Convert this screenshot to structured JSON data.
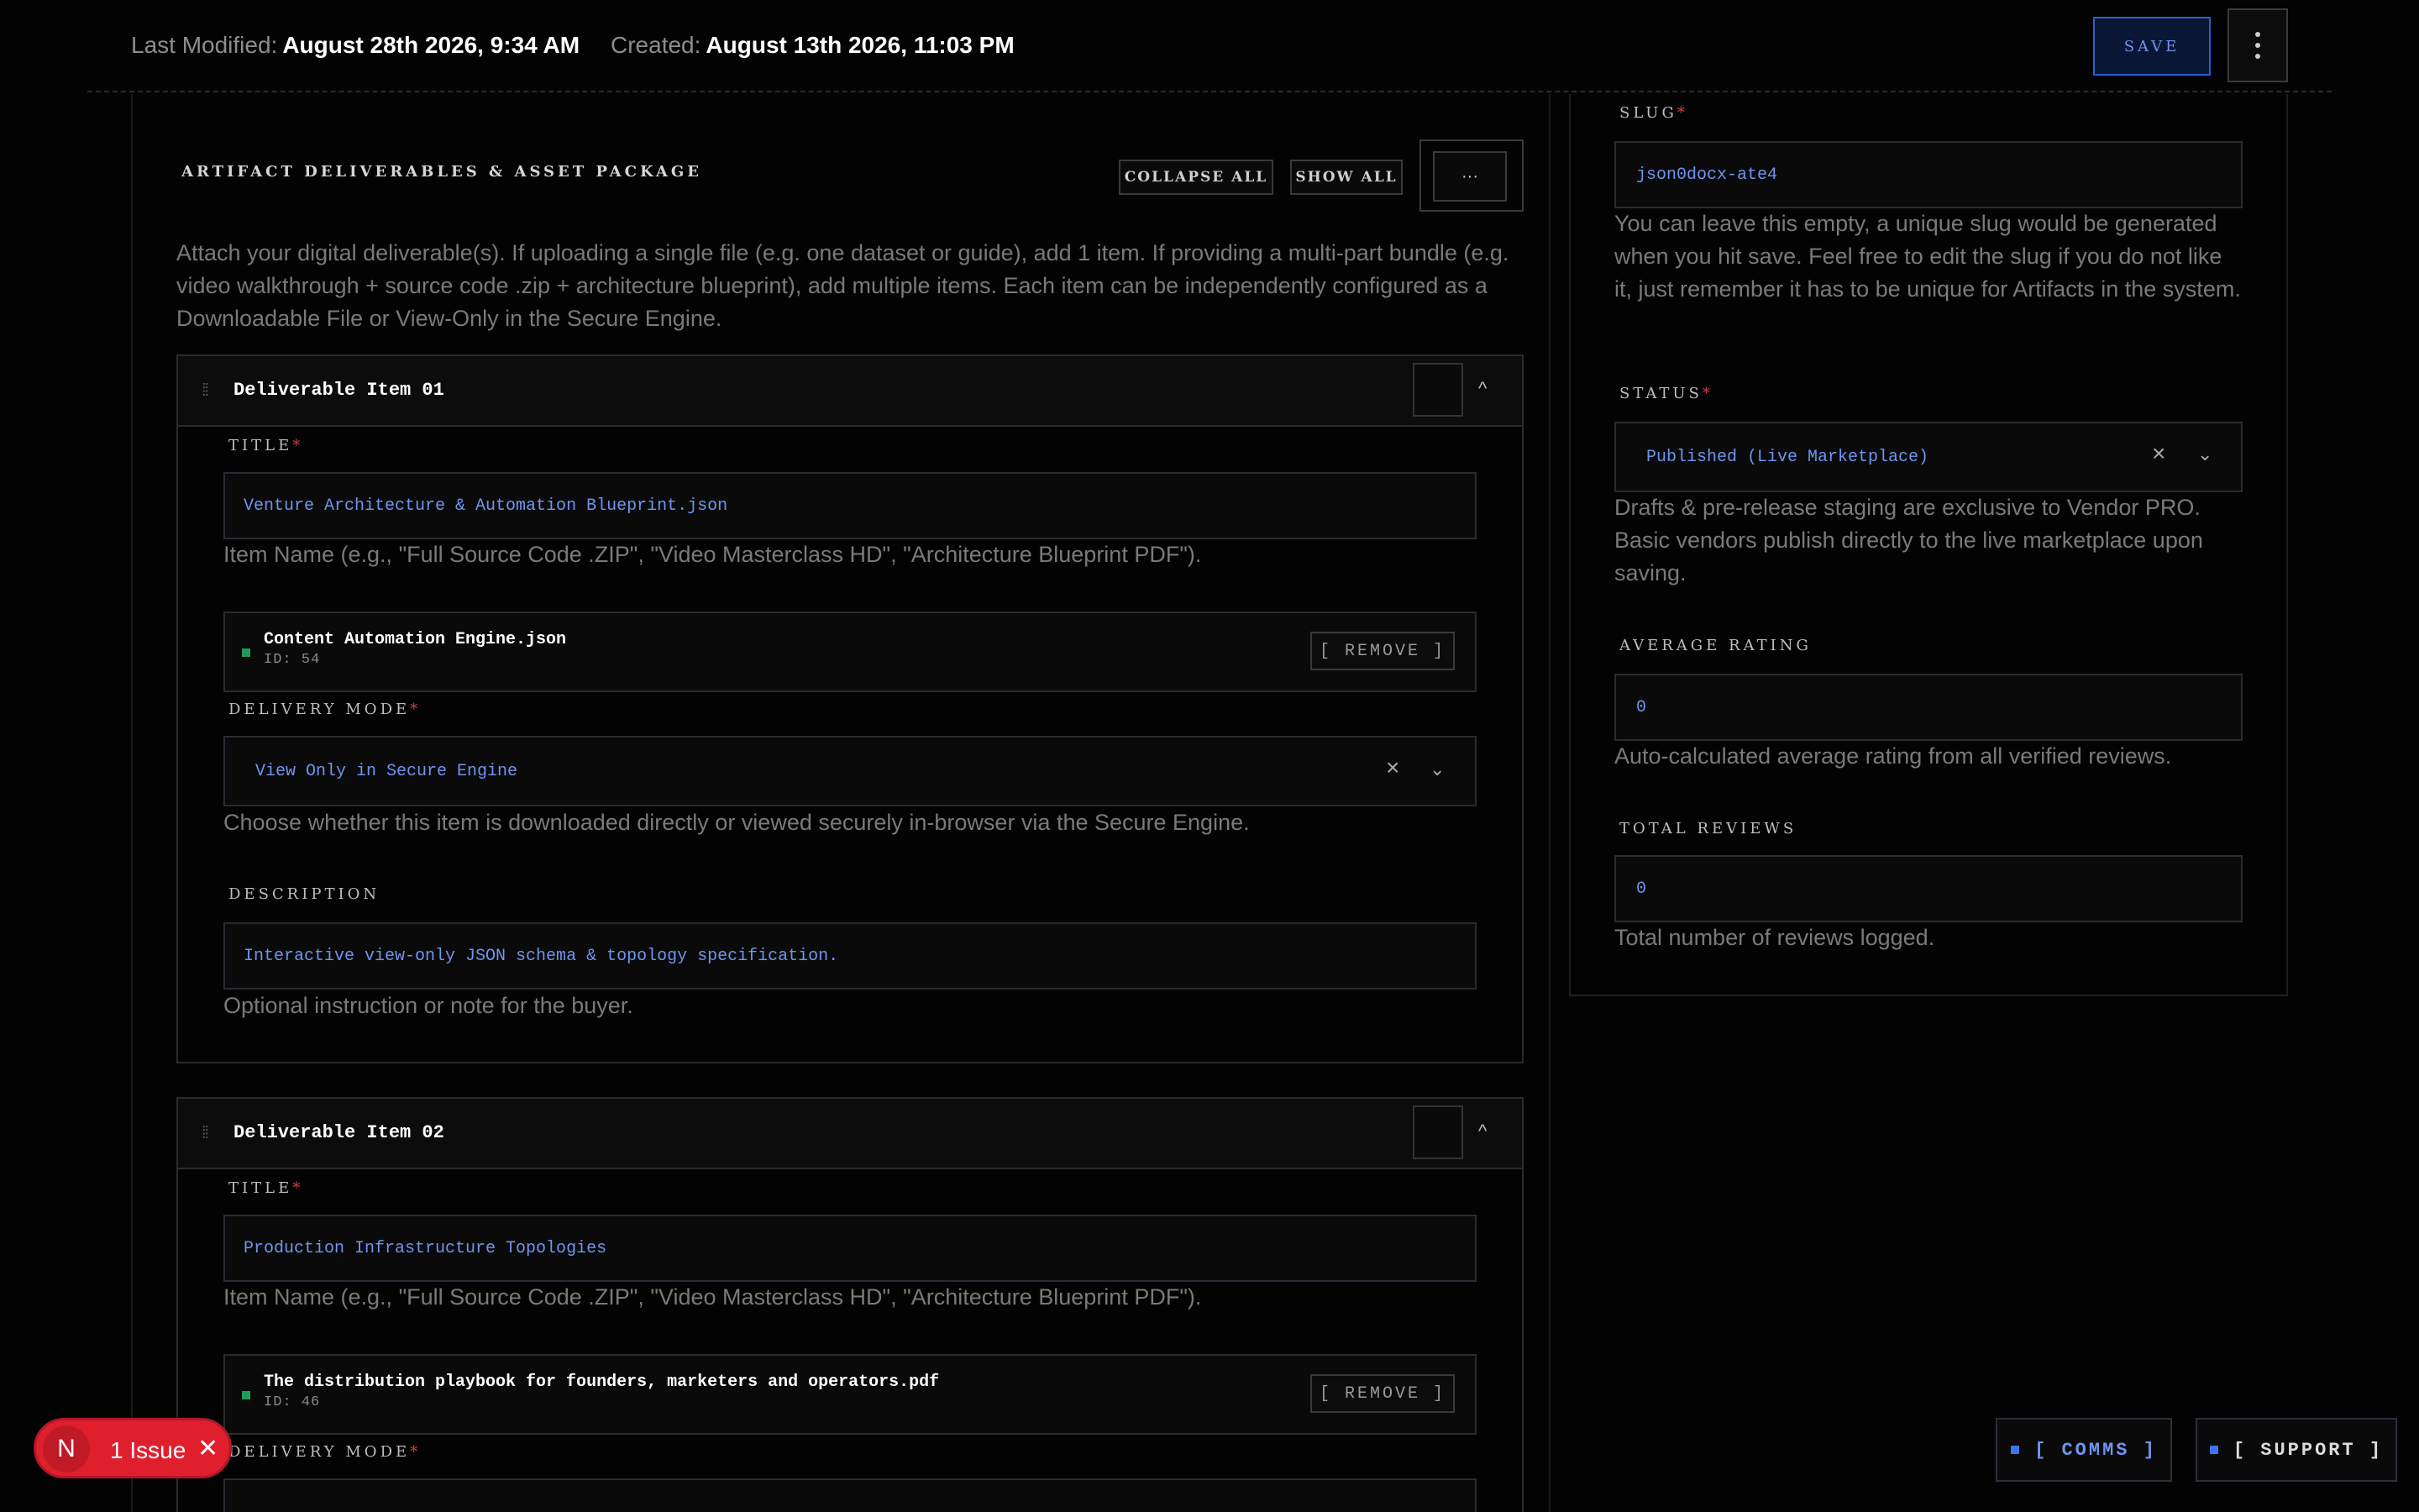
{
  "header": {
    "last_modified_label": "Last Modified:",
    "last_modified_value": "August 28th 2026, 9:34 AM",
    "created_label": "Created:",
    "created_value": "August 13th 2026, 11:03 PM",
    "save_label": "SAVE"
  },
  "deliverables": {
    "section_title": "ARTIFACT DELIVERABLES & ASSET PACKAGE",
    "collapse_all_label": "COLLAPSE ALL",
    "show_all_label": "SHOW ALL",
    "more_label": "···",
    "intro": "Attach your digital deliverable(s). If uploading a single file (e.g. one dataset or guide), add 1 item. If providing a multi-part bundle (e.g. video walkthrough + source code .zip + architecture blueprint), add multiple items. Each item can be independently configured as a Downloadable File or View-Only in the Secure Engine.",
    "items": [
      {
        "heading": "Deliverable Item 01",
        "title_label": "TITLE",
        "title_value": "Venture Architecture & Automation Blueprint.json",
        "title_help": "Item Name (e.g., \"Full Source Code .ZIP\", \"Video Masterclass HD\", \"Architecture Blueprint PDF\").",
        "file_name": "Content Automation Engine.json",
        "file_id": "ID: 54",
        "remove_label": "[ REMOVE ]",
        "delivery_label": "DELIVERY MODE",
        "delivery_value": "View Only in Secure Engine",
        "delivery_help": "Choose whether this item is downloaded directly or viewed securely in-browser via the Secure Engine.",
        "description_label": "DESCRIPTION",
        "description_value": "Interactive view-only JSON schema & topology specification.",
        "description_help": "Optional instruction or note for the buyer."
      },
      {
        "heading": "Deliverable Item 02",
        "title_label": "TITLE",
        "title_value": "Production Infrastructure Topologies",
        "title_help": "Item Name (e.g., \"Full Source Code .ZIP\", \"Video Masterclass HD\", \"Architecture Blueprint PDF\").",
        "file_name": "The distribution playbook for founders, marketers and operators.pdf",
        "file_id": "ID: 46",
        "remove_label": "[ REMOVE ]",
        "delivery_label": "DELIVERY MODE"
      }
    ]
  },
  "sidebar": {
    "slug_label": "SLUG",
    "slug_value": "json0docx-ate4",
    "slug_help": "You can leave this empty, a unique slug would be generated when you hit save. Feel free to edit the slug if you do not like it, just remember it has to be unique for Artifacts in the system.",
    "status_label": "STATUS",
    "status_value": "Published (Live Marketplace)",
    "status_help": "Drafts & pre-release staging are exclusive to Vendor PRO. Basic vendors publish directly to the live marketplace upon saving.",
    "avg_rating_label": "AVERAGE RATING",
    "avg_rating_value": "0",
    "avg_rating_help": "Auto-calculated average rating from all verified reviews.",
    "total_reviews_label": "TOTAL REVIEWS",
    "total_reviews_value": "0",
    "total_reviews_help": "Total number of reviews logged."
  },
  "floating": {
    "issue_badge_letter": "N",
    "issue_text": "1 Issue",
    "comms_label": "[ COMMS ]",
    "support_label": "[ SUPPORT ]"
  },
  "colors": {
    "accent": "#6f95f0",
    "required": "#e33b3b",
    "issue": "#e01f2d",
    "file_status": "#1f9d55"
  }
}
